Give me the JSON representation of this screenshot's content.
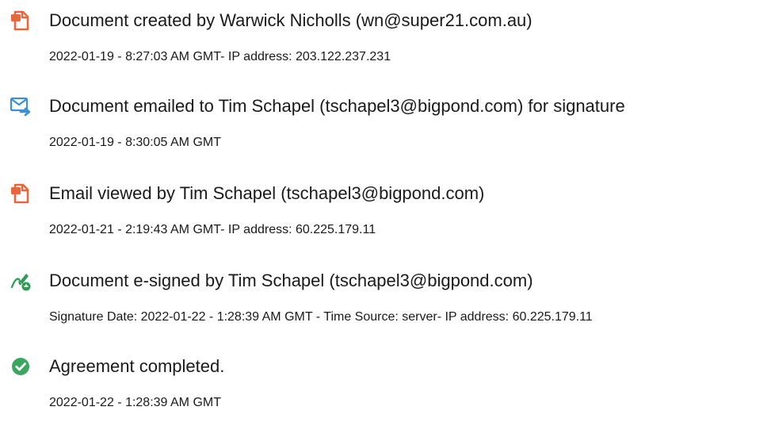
{
  "events": [
    {
      "icon": "document-created-icon",
      "title": "Document created by Warwick Nicholls (wn@super21.com.au)",
      "detail": "2022-01-19 - 8:27:03 AM GMT- IP address: 203.122.237.231"
    },
    {
      "icon": "email-sent-icon",
      "title": "Document emailed to Tim Schapel (tschapel3@bigpond.com) for signature",
      "detail": "2022-01-19 - 8:30:05 AM GMT"
    },
    {
      "icon": "document-viewed-icon",
      "title": "Email viewed by Tim Schapel (tschapel3@bigpond.com)",
      "detail": "2022-01-21 - 2:19:43 AM GMT- IP address: 60.225.179.11"
    },
    {
      "icon": "e-sign-pen-icon",
      "title": "Document e-signed by Tim Schapel (tschapel3@bigpond.com)",
      "detail": "Signature Date: 2022-01-22 - 1:28:39 AM GMT - Time Source: server- IP address: 60.225.179.11"
    },
    {
      "icon": "check-circle-icon",
      "title": "Agreement completed.",
      "detail": "2022-01-22 - 1:28:39 AM GMT"
    }
  ],
  "colors": {
    "doc_icon": "#e8663a",
    "mail_icon": "#3a8fd6",
    "sign_icon": "#2f9a55",
    "check_icon": "#3aa65e"
  }
}
